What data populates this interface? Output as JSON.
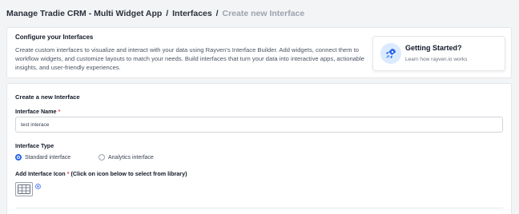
{
  "breadcrumb": {
    "app": "Manage Tradie CRM - Multi Widget App",
    "section": "Interfaces",
    "separator": "/",
    "current": "Create new Interface"
  },
  "intro": {
    "title": "Configure your Interfaces",
    "description": "Create custom interfaces to visualize and interact with your data using Rayven's Interface Builder. Add widgets, connect them to workflow widgets, and customize layouts to match your needs. Build interfaces that turn your data into interactive apps, actionable insights, and user-friendly experiences."
  },
  "getting_started": {
    "title": "Getting Started?",
    "subtitle": "Learn how rayven.io works",
    "icon": "rocket-icon"
  },
  "form": {
    "title": "Create a new Interface",
    "name_label": "Interface Name",
    "name_required": "*",
    "name_value": "test interace",
    "type_label": "Interface Type",
    "type_options": [
      {
        "label": "Standard interface",
        "checked": true
      },
      {
        "label": "Analytics interface",
        "checked": false
      }
    ],
    "icon_label": "Add Interface Icon",
    "icon_required": "*",
    "icon_hint": "(Click on icon below to select from library)",
    "selected_icon": "grid-icon"
  },
  "colors": {
    "accent": "#2563eb",
    "required": "#ef4444",
    "muted_text": "#9ca3af"
  }
}
